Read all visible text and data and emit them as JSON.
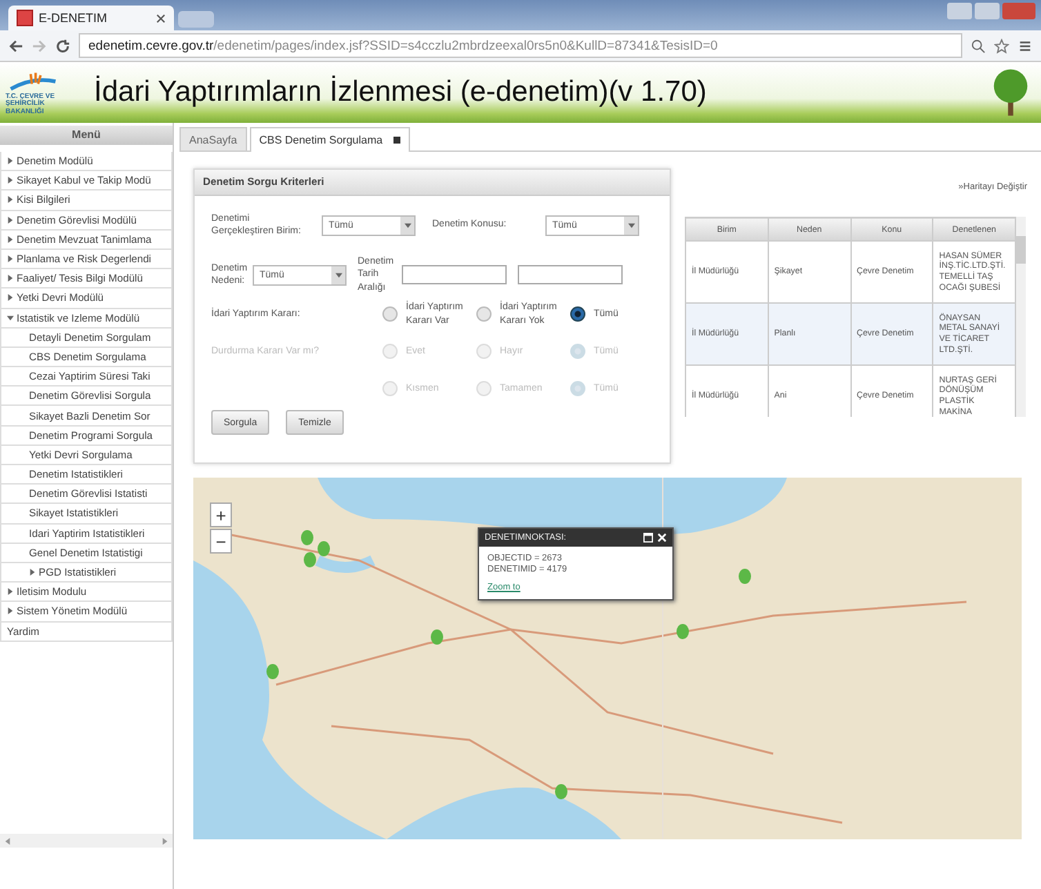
{
  "browser": {
    "tab_title": "E-DENETIM",
    "url_host": "edenetim.cevre.gov.tr",
    "url_path": "/edenetim/pages/index.jsf?SSID=s4cczlu2mbrdzeexal0rs5n0&KullD=87341&TesisID=0"
  },
  "header": {
    "logo_text": "T.C. ÇEVRE VE ŞEHİRCİLİK BAKANLIĞI",
    "title": "İdari Yaptırımların İzlenmesi (e-denetim)(v 1.70)"
  },
  "menu": {
    "title": "Menü",
    "items": [
      {
        "label": "Denetim Modülü",
        "expanded": false
      },
      {
        "label": "Sikayet Kabul ve Takip Modü",
        "expanded": false
      },
      {
        "label": "Kisi Bilgileri",
        "expanded": false
      },
      {
        "label": "Denetim Görevlisi Modülü",
        "expanded": false
      },
      {
        "label": "Denetim Mevzuat Tanimlama",
        "expanded": false
      },
      {
        "label": "Planlama ve Risk Degerlendi",
        "expanded": false
      },
      {
        "label": "Faaliyet/ Tesis Bilgi Modülü",
        "expanded": false
      },
      {
        "label": "Yetki Devri Modülü",
        "expanded": false
      },
      {
        "label": "Istatistik ve Izleme Modülü",
        "expanded": true,
        "children": [
          {
            "label": "Detayli Denetim Sorgulam"
          },
          {
            "label": "CBS Denetim Sorgulama"
          },
          {
            "label": "Cezai Yaptirim Süresi Taki"
          },
          {
            "label": "Denetim Görevlisi Sorgula"
          },
          {
            "label": "Sikayet Bazli Denetim Sor"
          },
          {
            "label": "Denetim Programi Sorgula"
          },
          {
            "label": "Yetki Devri Sorgulama"
          },
          {
            "label": "Denetim Istatistikleri"
          },
          {
            "label": "Denetim Görevlisi Istatisti"
          },
          {
            "label": "Sikayet Istatistikleri"
          },
          {
            "label": "Idari Yaptirim Istatistikleri"
          },
          {
            "label": "Genel Denetim Istatistigi"
          },
          {
            "label": "PGD Istatistikleri",
            "expanded": false
          }
        ]
      },
      {
        "label": "Iletisim Modulu",
        "expanded": false
      },
      {
        "label": "Sistem Yönetim Modülü",
        "expanded": false
      },
      {
        "label": "Yardim"
      }
    ]
  },
  "tabs": [
    {
      "label": "AnaSayfa",
      "selected": false
    },
    {
      "label": "CBS Denetim Sorgulama",
      "selected": true,
      "closable": true
    }
  ],
  "form": {
    "title": "Denetim Sorgu Kriterleri",
    "birim": {
      "label": "Denetimi Gerçekleştiren Birim:",
      "value": "Tümü"
    },
    "konu": {
      "label": "Denetim Konusu:",
      "value": "Tümü"
    },
    "neden": {
      "label": "Denetim Nedeni:",
      "value": "Tümü"
    },
    "tarih": {
      "label": "Denetim Tarih Aralığı"
    },
    "radio_groups": [
      {
        "label": "İdari Yaptırım Kararı:",
        "disabled": false,
        "options": [
          {
            "label": "İdari Yaptırım Kararı Var",
            "selected": false
          },
          {
            "label": "İdari Yaptırım Kararı Yok",
            "selected": false
          },
          {
            "label": "Tümü",
            "selected": true
          }
        ]
      },
      {
        "label": "Durdurma Kararı Var mı?",
        "disabled": true,
        "options": [
          {
            "label": "Evet",
            "selected": false
          },
          {
            "label": "Hayır",
            "selected": false
          },
          {
            "label": "Tümü",
            "selected": true
          }
        ]
      },
      {
        "disabled": true,
        "options": [
          {
            "label": "Kısmen",
            "selected": false
          },
          {
            "label": "Tamamen",
            "selected": false
          },
          {
            "label": "Tümü",
            "selected": true
          }
        ]
      }
    ],
    "buttons": [
      "Sorgula",
      "Temizle"
    ]
  },
  "map_switch_link": "»Haritayı Değiştir",
  "table": {
    "columns": [
      "Birim",
      "Neden",
      "Konu",
      "Denetlenen"
    ],
    "rows": [
      {
        "cells": [
          "İl Müdürlüğü",
          "Şikayet",
          "Çevre Denetim",
          "HASAN SÜMER İNŞ.TİC.LTD.ŞTİ. TEMELLİ TAŞ OCAĞI ŞUBESİ"
        ],
        "selected": false
      },
      {
        "cells": [
          "İl Müdürlüğü",
          "Planlı",
          "Çevre Denetim",
          "ÖNAYSAN METAL SANAYİ VE TİCARET LTD.ŞTİ."
        ],
        "selected": true
      },
      {
        "cells": [
          "İl Müdürlüğü",
          "Ani",
          "Çevre Denetim",
          "NURTAŞ GERİ DÖNÜŞÜM PLASTİK MAKİNA"
        ],
        "selected": false
      }
    ]
  },
  "map": {
    "zoom_in": "+",
    "zoom_out": "−",
    "popup": {
      "title": "DENETIMNOKTASI:",
      "lines": [
        "OBJECTID = 2673",
        "DENETIMID = 4179"
      ],
      "link": "Zoom to"
    }
  }
}
